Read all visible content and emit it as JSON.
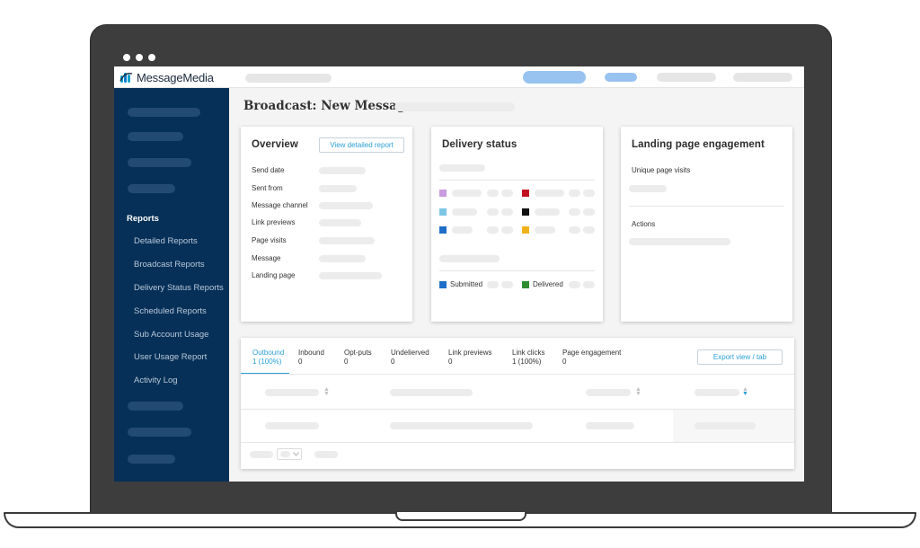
{
  "app": {
    "name": "MessageMedia"
  },
  "colors": {
    "accent": "#2a9fd6",
    "sidebar": "#063057",
    "brand_logo": "#0a7fd0"
  },
  "sidebar": {
    "section_title": "Reports",
    "items": [
      {
        "label": "Detailed Reports"
      },
      {
        "label": "Broadcast Reports"
      },
      {
        "label": "Delivery Status Reports"
      },
      {
        "label": "Scheduled Reports"
      },
      {
        "label": "Sub Account Usage"
      },
      {
        "label": "User Usage Report"
      },
      {
        "label": "Activity Log"
      }
    ]
  },
  "page": {
    "title": "Broadcast: New Message"
  },
  "overview": {
    "title": "Overview",
    "button": "View detailed report",
    "fields": [
      "Send date",
      "Sent from",
      "Message channel",
      "Link previews",
      "Page visits",
      "Message",
      "Landing page"
    ]
  },
  "delivery": {
    "title": "Delivery status",
    "status_colors": [
      "#c99be0",
      "#c0111f",
      "#7ec6e6",
      "#111111",
      "#1f6fc8",
      "#f0b21c"
    ],
    "legend": [
      {
        "label": "Submitted",
        "color": "#1f6fc8"
      },
      {
        "label": "Delivered",
        "color": "#2e8b2e"
      }
    ]
  },
  "landing": {
    "title": "Landing page engagement",
    "unique_visits": "Unique page visits",
    "actions": "Actions"
  },
  "tabs": [
    {
      "label": "Outbound",
      "value": "1 (100%)"
    },
    {
      "label": "Inbound",
      "value": "0"
    },
    {
      "label": "Opt-puts",
      "value": "0"
    },
    {
      "label": "Undelierved",
      "value": "0"
    },
    {
      "label": "Link previews",
      "value": "0"
    },
    {
      "label": "Link clicks",
      "value": "1 (100%)"
    },
    {
      "label": "Page engagement",
      "value": "0"
    }
  ],
  "export_button": "Export view / tab"
}
